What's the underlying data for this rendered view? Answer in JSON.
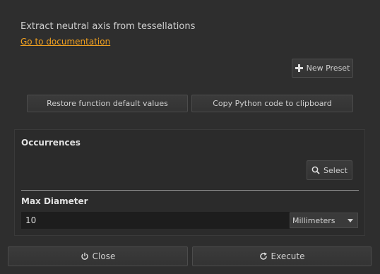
{
  "header": {
    "description": "Extract neutral axis from tessellations",
    "doc_link": "Go to documentation"
  },
  "toolbar": {
    "new_preset_label": "New Preset",
    "new_preset_icon": "plus-icon",
    "restore_label": "Restore function default values",
    "copy_label": "Copy Python code to clipboard"
  },
  "occurrences": {
    "title": "Occurrences",
    "select_label": "Select",
    "select_icon": "magnifier-icon"
  },
  "max_diameter": {
    "title": "Max Diameter",
    "value": "10",
    "unit": "Millimeters"
  },
  "footer": {
    "close_label": "Close",
    "close_icon": "power-icon",
    "execute_label": "Execute",
    "execute_icon": "refresh-icon"
  },
  "colors": {
    "background": "#2e2e2e",
    "link": "#f0a020"
  }
}
